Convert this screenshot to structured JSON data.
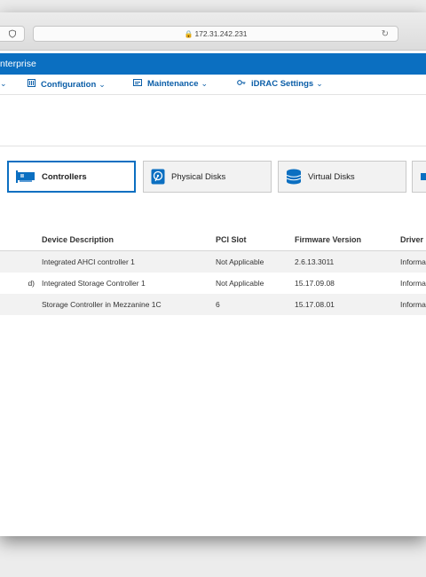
{
  "browser": {
    "url": "172.31.242.231"
  },
  "app": {
    "product_name": "nterprise"
  },
  "nav": {
    "items": [
      {
        "label": "Configuration"
      },
      {
        "label": "Maintenance"
      },
      {
        "label": "iDRAC Settings"
      }
    ]
  },
  "tabs": [
    {
      "label": "Controllers",
      "icon": "controller-card-icon",
      "active": true
    },
    {
      "label": "Physical Disks",
      "icon": "hard-disk-icon",
      "active": false
    },
    {
      "label": "Virtual Disks",
      "icon": "database-icon",
      "active": false
    }
  ],
  "table": {
    "headers": [
      "",
      "Device Description",
      "PCI Slot",
      "Firmware Version",
      "Driver"
    ],
    "rows": [
      [
        "",
        "Integrated AHCI controller 1",
        "Not Applicable",
        "2.6.13.3011",
        "Informa"
      ],
      [
        "d)",
        "Integrated Storage Controller 1",
        "Not Applicable",
        "15.17.09.08",
        "Informa"
      ],
      [
        "",
        "Storage Controller in Mezzanine 1C",
        "6",
        "15.17.08.01",
        "Informa"
      ]
    ]
  },
  "colors": {
    "brand_blue": "#0b6fc1",
    "nav_text": "#0b5ea8",
    "row_stripe": "#f2f2f2"
  }
}
